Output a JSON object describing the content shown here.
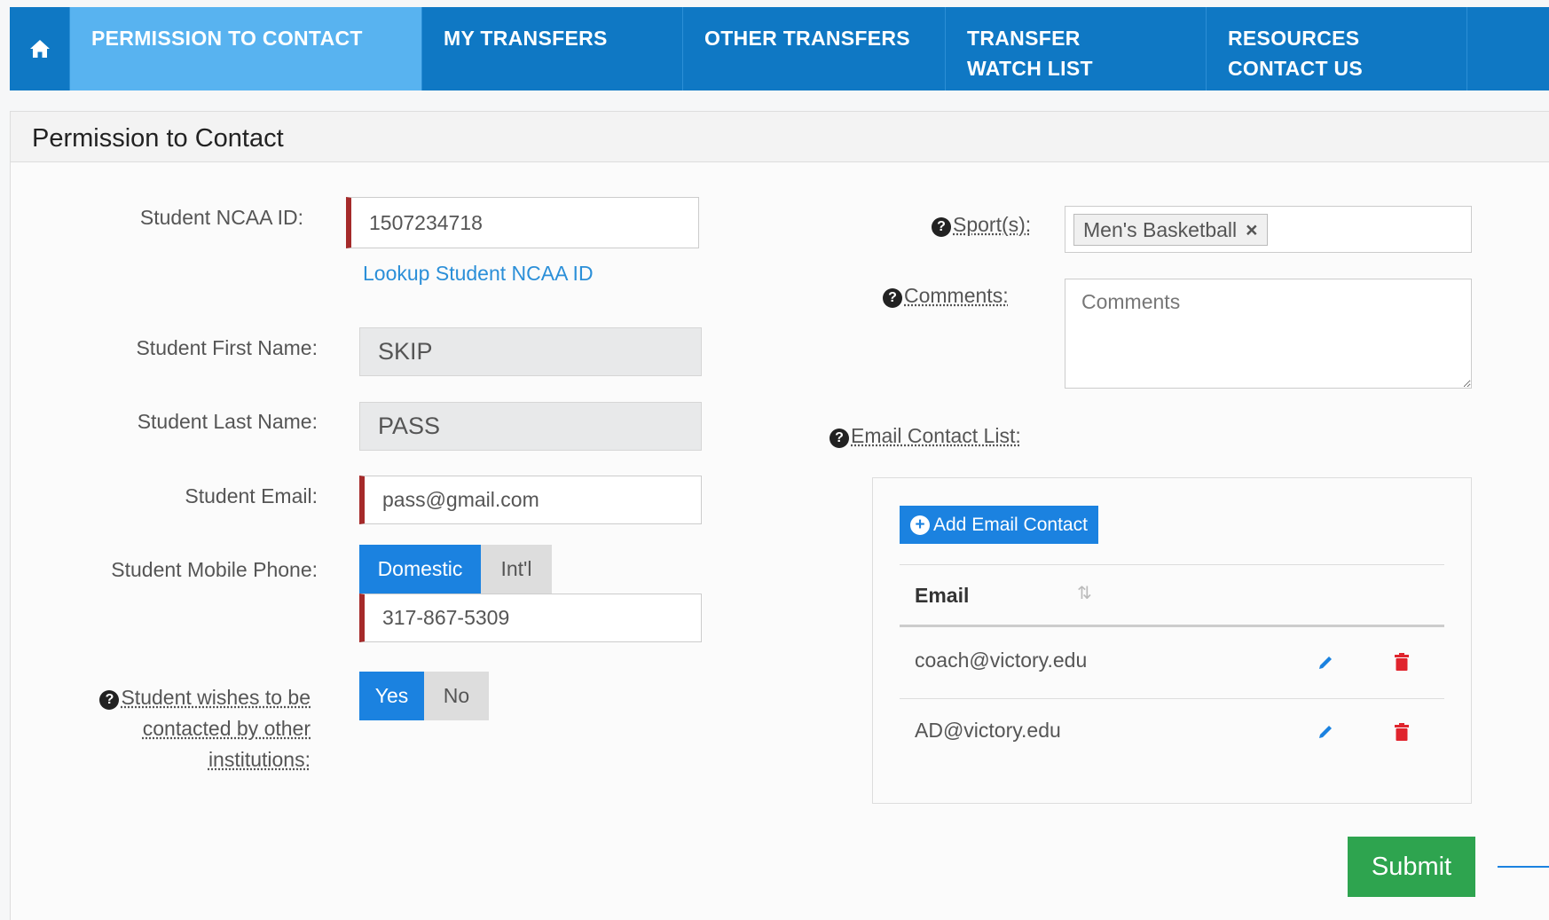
{
  "nav": {
    "items": [
      {
        "label": "PERMISSION TO CONTACT",
        "active": true
      },
      {
        "label": "MY TRANSFERS"
      },
      {
        "label": "OTHER TRANSFERS"
      },
      {
        "label": "TRANSFER\nWATCH LIST"
      },
      {
        "label": "RESOURCES\nCONTACT US"
      }
    ],
    "home_icon": "home-icon"
  },
  "panel": {
    "title": "Permission to Contact"
  },
  "form": {
    "ncaa_id_label": "Student NCAA ID:",
    "ncaa_id_value": "1507234718",
    "lookup_link": "Lookup Student NCAA ID",
    "first_name_label": "Student First Name:",
    "first_name_value": "SKIP",
    "last_name_label": "Student Last Name:",
    "last_name_value": "PASS",
    "email_label": "Student Email:",
    "email_value": "pass@gmail.com",
    "phone_label": "Student Mobile Phone:",
    "phone_toggle": {
      "domestic": "Domestic",
      "intl": "Int'l",
      "selected": "Domestic"
    },
    "phone_value": "317-867-5309",
    "wishes_label": "Student wishes to be contacted by other institutions:",
    "wishes_toggle": {
      "yes": "Yes",
      "no": "No",
      "selected": "Yes"
    },
    "sports_label": "Sport(s):",
    "sport_tag": "Men's Basketball",
    "comments_label": "Comments:",
    "comments_placeholder": "Comments",
    "email_list_label": "Email Contact List:"
  },
  "email_table": {
    "add_button": "Add Email Contact",
    "header": "Email",
    "rows": [
      "coach@victory.edu",
      "AD@victory.edu"
    ]
  },
  "submit_label": "Submit",
  "colors": {
    "nav": "#0f78c4",
    "nav_active": "#58b3f0",
    "primary": "#1b82e0",
    "submit": "#2ea44f",
    "required": "#a52a2a"
  }
}
